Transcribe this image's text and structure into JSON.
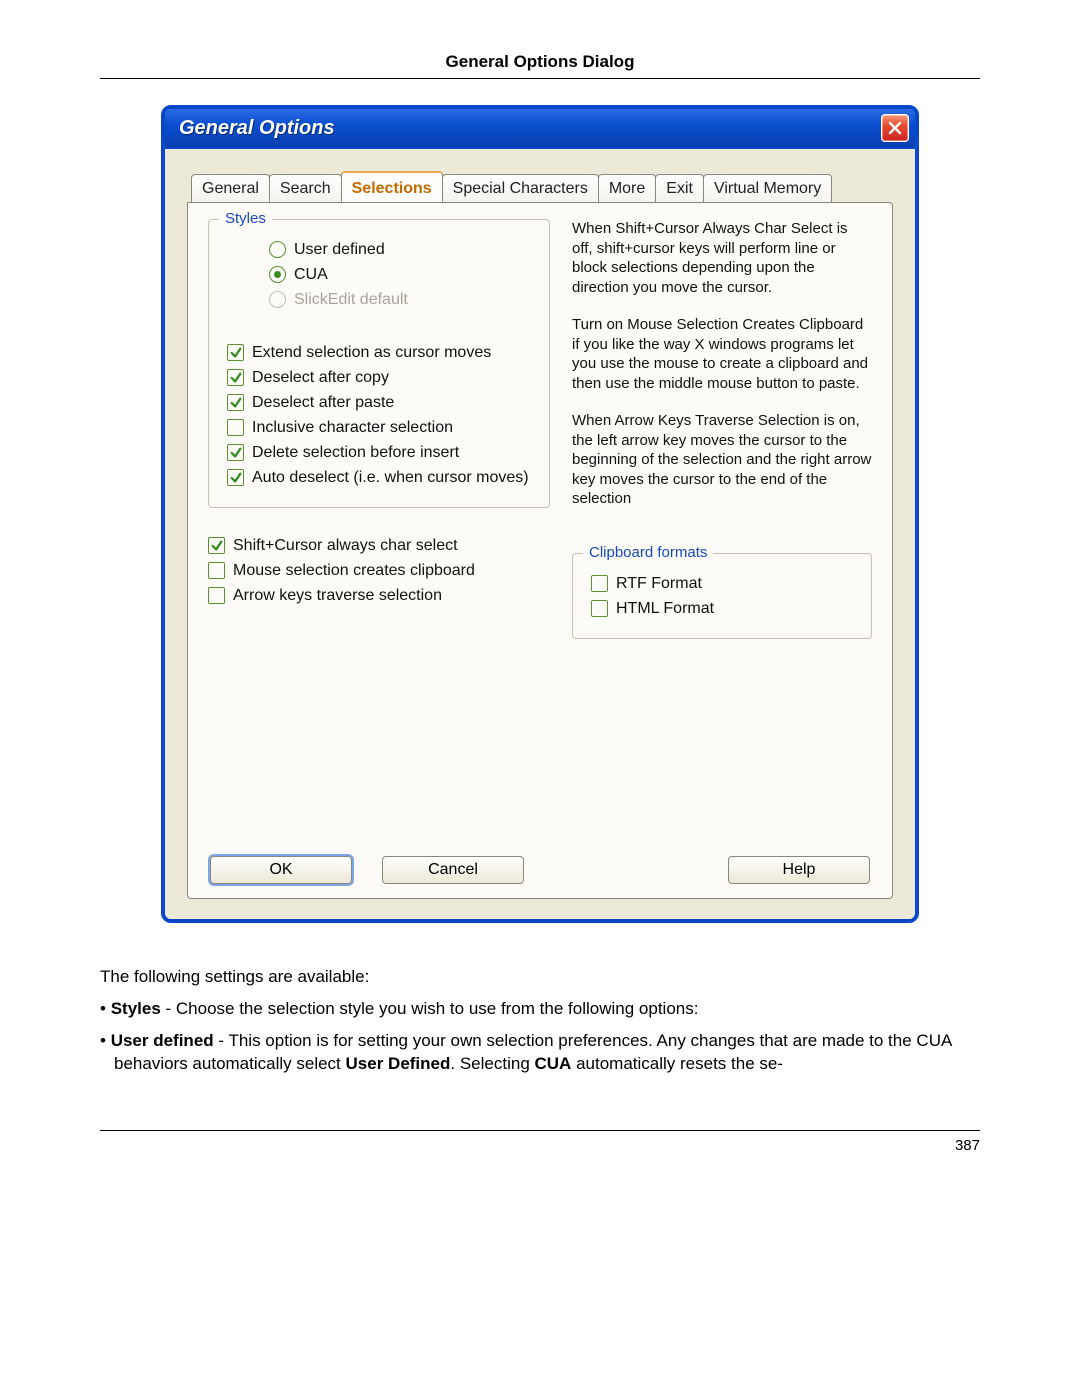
{
  "pageHeading": "General Options Dialog",
  "pageNumber": "387",
  "window": {
    "title": "General Options",
    "tabs": [
      "General",
      "Search",
      "Selections",
      "Special Characters",
      "More",
      "Exit",
      "Virtual Memory"
    ],
    "activeTabIndex": 2,
    "stylesGroup": {
      "legend": "Styles",
      "radios": [
        {
          "label": "User defined",
          "checked": false,
          "disabled": false
        },
        {
          "label": "CUA",
          "checked": true,
          "disabled": false
        },
        {
          "label": "SlickEdit default",
          "checked": false,
          "disabled": true
        }
      ],
      "checks1": [
        {
          "label": "Extend selection as cursor moves",
          "checked": true
        },
        {
          "label": "Deselect after copy",
          "checked": true
        },
        {
          "label": "Deselect after paste",
          "checked": true
        },
        {
          "label": "Inclusive character selection",
          "checked": false
        },
        {
          "label": "Delete selection before insert",
          "checked": true
        },
        {
          "label": "Auto deselect (i.e. when cursor moves)",
          "checked": true
        }
      ]
    },
    "checks2": [
      {
        "label": "Shift+Cursor always char select",
        "checked": true
      },
      {
        "label": "Mouse selection creates clipboard",
        "checked": false
      },
      {
        "label": "Arrow keys traverse selection",
        "checked": false
      }
    ],
    "desc": [
      "When Shift+Cursor Always Char Select is off, shift+cursor keys will perform line or block selections depending upon the direction you move the cursor.",
      "Turn on Mouse Selection Creates Clipboard if you like the way X windows programs let you use the mouse to create a clipboard and then use the middle mouse button to paste.",
      "When Arrow Keys Traverse Selection is on, the left arrow key moves the cursor to the beginning of the selection and the right arrow key moves the cursor to the end of the selection"
    ],
    "clipGroup": {
      "legend": "Clipboard formats",
      "checks": [
        {
          "label": "RTF Format",
          "checked": false
        },
        {
          "label": "HTML Format",
          "checked": false
        }
      ]
    },
    "buttons": {
      "ok": "OK",
      "cancel": "Cancel",
      "help": "Help"
    }
  },
  "doc": {
    "intro": "The following settings are available:",
    "b1_label": "Styles",
    "b1_rest": " - Choose the selection style you wish to use from the following options:",
    "b2_label": "User defined",
    "b2_rest1": " - This option is for setting your own selection preferences. Any changes that are made to the CUA behaviors automatically select ",
    "b2_strong1": "User Defined",
    "b2_rest2": ". Selecting ",
    "b2_strong2": "CUA",
    "b2_rest3": " automatically resets the se-"
  }
}
